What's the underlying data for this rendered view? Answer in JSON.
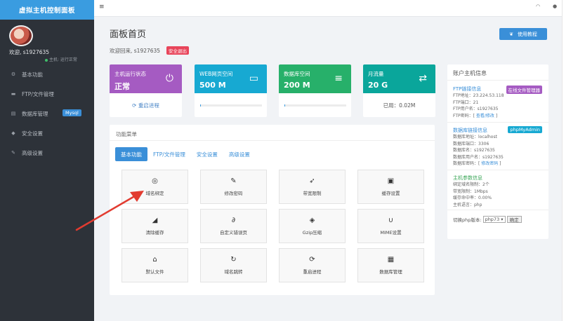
{
  "sidebar": {
    "brand": "虚拟主机控制面板",
    "welcome": "欢迎, s1927635",
    "status": "主机: 运行正常",
    "items": [
      {
        "label": "基本功能",
        "icon": "gear-icon",
        "glyph": "⚙"
      },
      {
        "label": "FTP/文件管理",
        "icon": "folder-icon",
        "glyph": "▬"
      },
      {
        "label": "数据库管理",
        "icon": "database-icon",
        "glyph": "▤",
        "badge": "Mysql"
      },
      {
        "label": "安全设置",
        "icon": "shield-icon",
        "glyph": "◆"
      },
      {
        "label": "高级设置",
        "icon": "edit-icon",
        "glyph": "✎"
      }
    ]
  },
  "header": {
    "title": "面板首页",
    "welcome": "欢迎回来, s1927635",
    "logout": "安全退出",
    "help": "使用教程"
  },
  "stats": [
    {
      "label": "主机运行状态",
      "value": "正常",
      "footer": "重启进程",
      "color": "#a55bc2",
      "icon": "power-icon",
      "glyph": "⏻"
    },
    {
      "label": "WEB网页空间",
      "value": "500 M",
      "footer": "",
      "color": "#17a9d2",
      "icon": "harddrive-icon",
      "glyph": "▭",
      "usage": 0.01
    },
    {
      "label": "数据库空间",
      "value": "200 M",
      "footer": "",
      "color": "#27b06a",
      "icon": "database-icon",
      "glyph": "≡",
      "usage": 0.01
    },
    {
      "label": "月流量",
      "value": "20 G",
      "footer": "已用：0.02M",
      "color": "#0aa69b",
      "icon": "exchange-icon",
      "glyph": "⇄"
    }
  ],
  "functions": {
    "title": "功能菜单",
    "tabs": [
      "基本功能",
      "FTP/文件管理",
      "安全设置",
      "高级设置"
    ],
    "tiles": [
      {
        "label": "域名绑定",
        "icon": "globe-icon",
        "glyph": "◎"
      },
      {
        "label": "修改密码",
        "icon": "wrench-icon",
        "glyph": "✎"
      },
      {
        "label": "带宽限制",
        "icon": "rocket-icon",
        "glyph": "➶"
      },
      {
        "label": "缓存设置",
        "icon": "save-icon",
        "glyph": "▣"
      },
      {
        "label": "清除缓存",
        "icon": "eraser-icon",
        "glyph": "◢"
      },
      {
        "label": "自定义错误页",
        "icon": "paperclip-icon",
        "glyph": "∂"
      },
      {
        "label": "Gzip压缩",
        "icon": "dropbox-icon",
        "glyph": "◈"
      },
      {
        "label": "MIME设置",
        "icon": "magnet-icon",
        "glyph": "∪"
      },
      {
        "label": "默认文件",
        "icon": "home-icon",
        "glyph": "⌂"
      },
      {
        "label": "域名跳转",
        "icon": "redo-icon",
        "glyph": "↻"
      },
      {
        "label": "重启进程",
        "icon": "refresh-icon",
        "glyph": "⟳"
      },
      {
        "label": "数据库管理",
        "icon": "table-icon",
        "glyph": "▦"
      }
    ]
  },
  "account": {
    "title": "账户主机信息",
    "ftp": {
      "title": "FTP链接信息",
      "tag": "在线文件管理器",
      "lines": [
        "FTP地址：23.224.53.118",
        "FTP端口：21",
        "FTP用户名：s1927635"
      ],
      "pw_prefix": "FTP密码：[ ",
      "pw_link": "查看/修改",
      "pw_suffix": " ]"
    },
    "db": {
      "title": "数据库链接信息",
      "tag": "phpMyAdmin",
      "lines": [
        "数据库地址：localhost",
        "数据库端口：3306",
        "数据库名：s1927635",
        "数据库用户名：s1927635"
      ],
      "pw_prefix": "数据库密码：[ ",
      "pw_link": "修改密码",
      "pw_suffix": " ]"
    },
    "params": {
      "title": "主机参数信息",
      "lines": [
        "绑定域名限制：2个",
        "带宽限制：1Mbps",
        "缓存命中率：0.00%",
        "主机语言：php"
      ]
    },
    "php": {
      "label": "切换php版本:",
      "selected": "php73",
      "ok": "确定"
    }
  }
}
